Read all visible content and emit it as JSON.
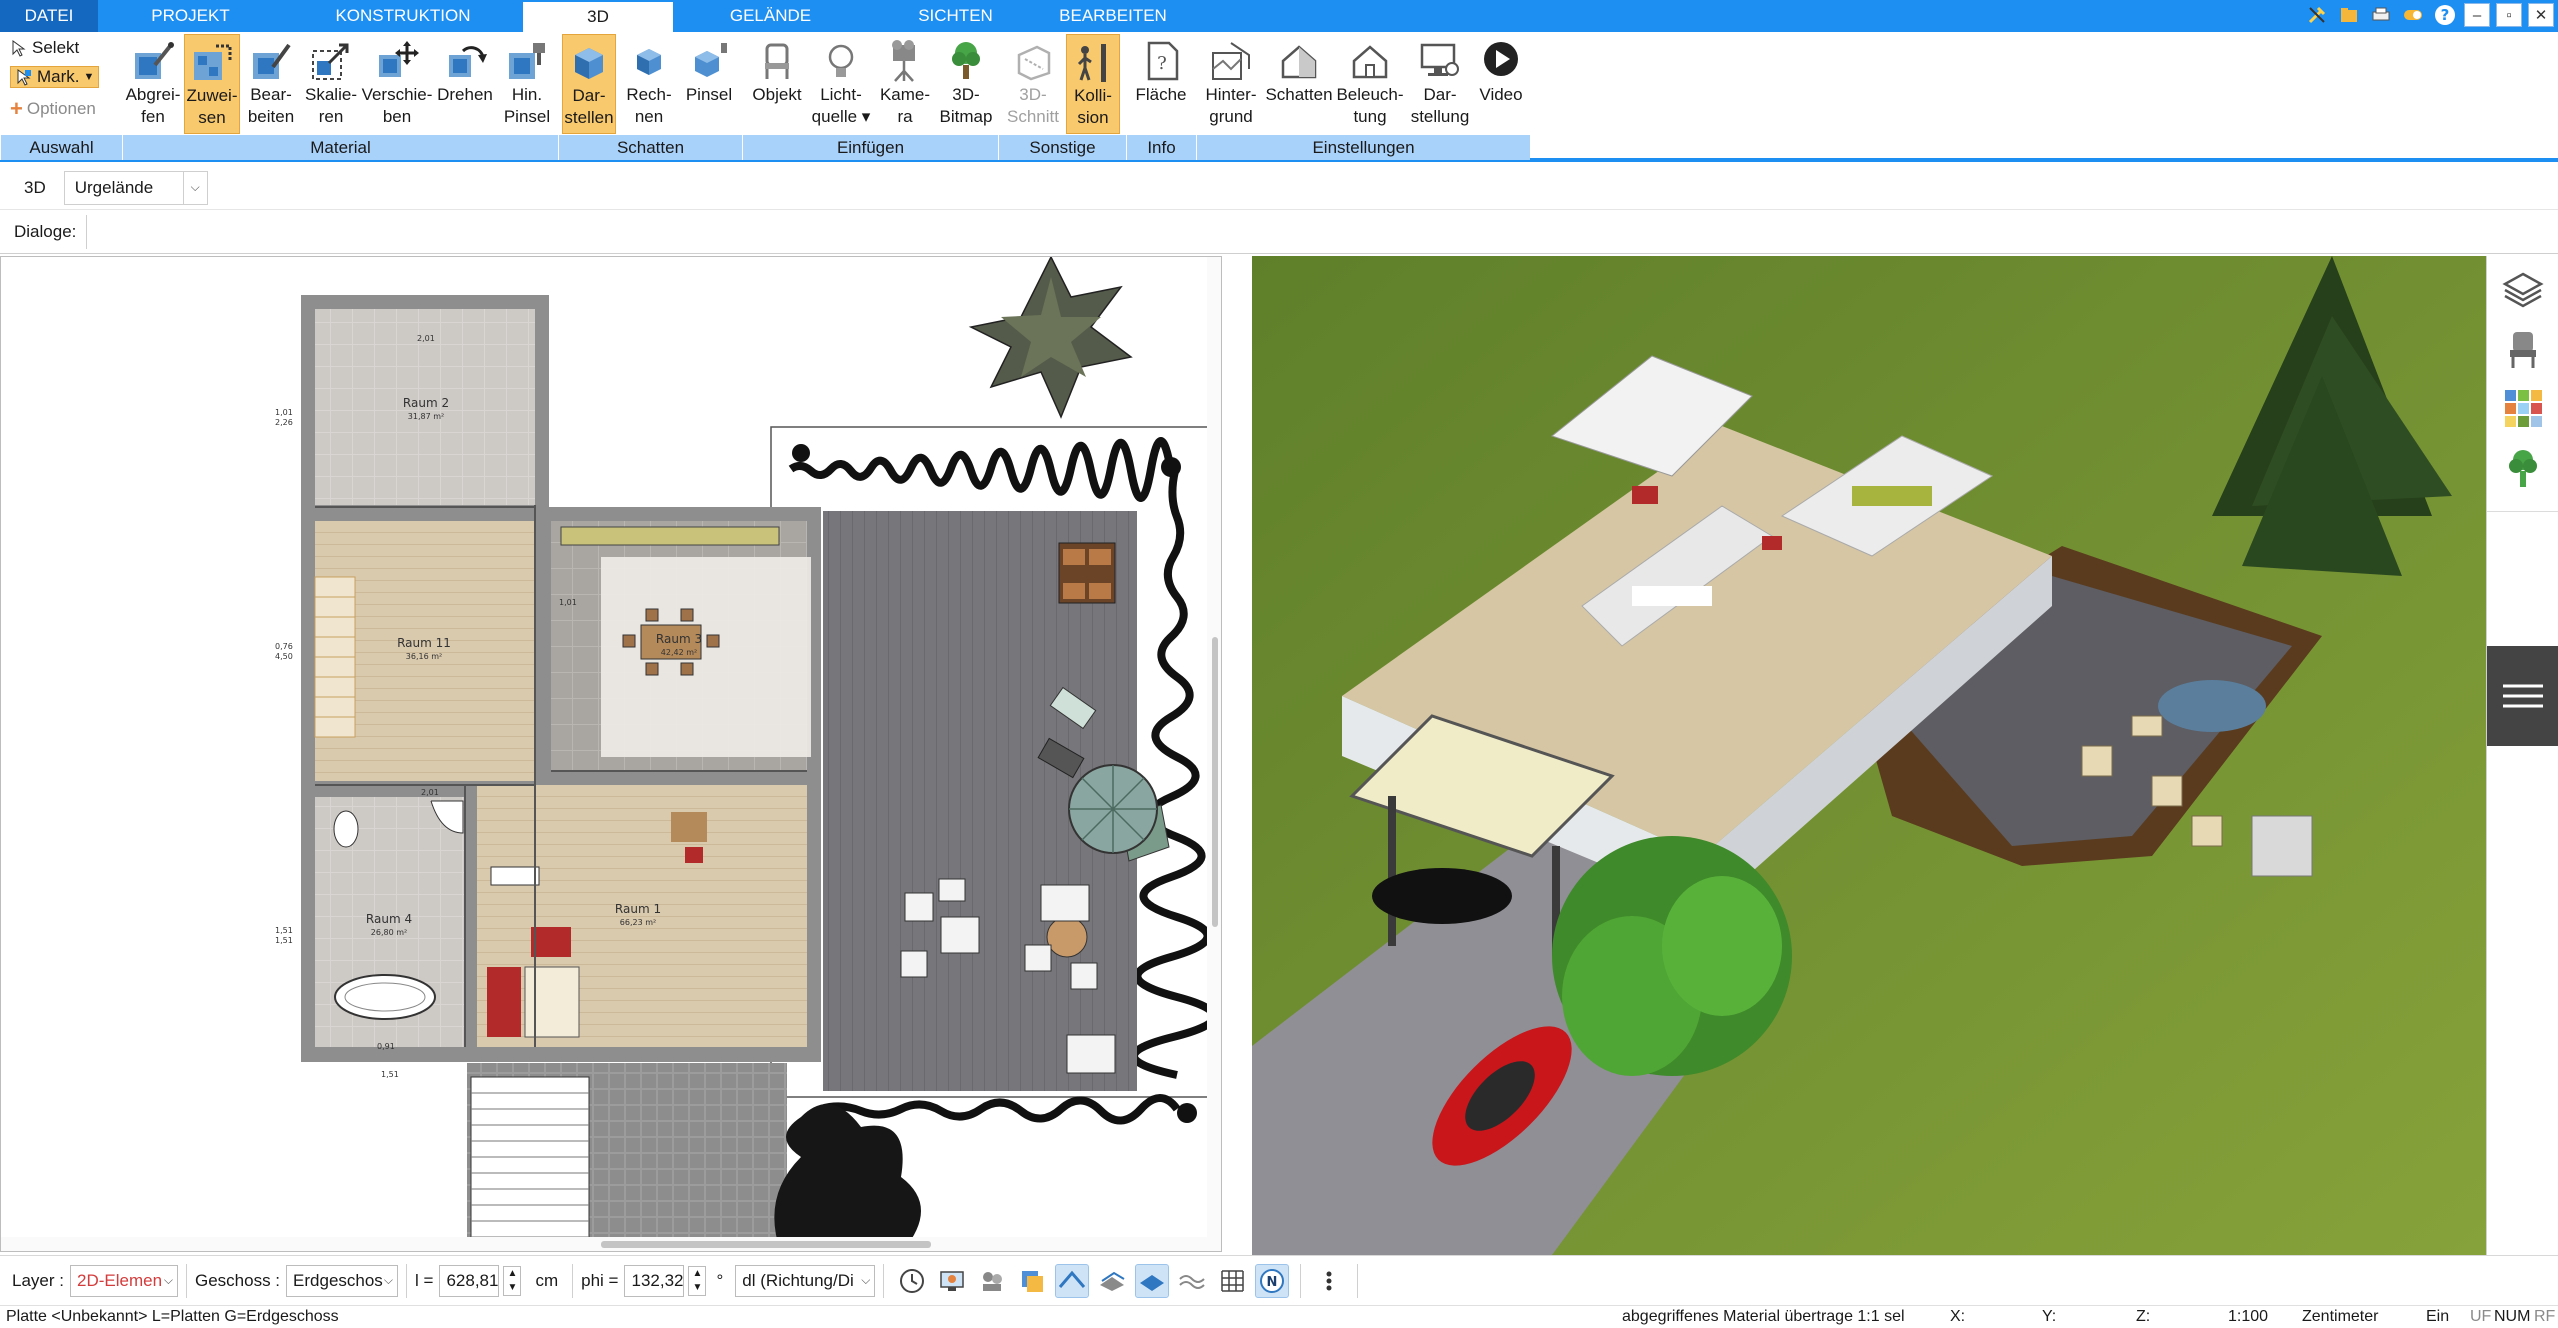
{
  "tabs": [
    {
      "label": "DATEI",
      "active": false
    },
    {
      "label": "PROJEKT",
      "active": false
    },
    {
      "label": "KONSTRUKTION",
      "active": false
    },
    {
      "label": "3D",
      "active": true
    },
    {
      "label": "GELÄNDE",
      "active": false
    },
    {
      "label": "SICHTEN",
      "active": false
    },
    {
      "label": "BEARBEITEN",
      "active": false
    }
  ],
  "window_controls": [
    "tools-icon",
    "folder-icon",
    "print-icon",
    "toggle-icon",
    "help-icon",
    "minimize-icon",
    "restore-icon",
    "close-icon"
  ],
  "ribbon": {
    "auswahl": {
      "label": "Auswahl",
      "selekt": "Selekt",
      "mark": "Mark.",
      "optionen": "Optionen"
    },
    "material": {
      "label": "Material",
      "buttons": [
        {
          "line1": "Abgrei-",
          "line2": "fen",
          "icon": "eyedropper-icon",
          "active": false
        },
        {
          "line1": "Zuwei-",
          "line2": "sen",
          "icon": "assign-material-icon",
          "active": true
        },
        {
          "line1": "Bear-",
          "line2": "beiten",
          "icon": "edit-material-icon",
          "active": false
        },
        {
          "line1": "Skalie-",
          "line2": "ren",
          "icon": "scale-icon",
          "active": false
        },
        {
          "line1": "Verschie-",
          "line2": "ben",
          "icon": "move-icon",
          "active": false
        },
        {
          "line1": "Drehen",
          "line2": "",
          "icon": "rotate-icon",
          "active": false
        },
        {
          "line1": "Hin.",
          "line2": "Pinsel",
          "icon": "brush-icon",
          "active": false
        }
      ]
    },
    "schatten": {
      "label": "Schatten",
      "buttons": [
        {
          "line1": "Dar-",
          "line2": "stellen",
          "icon": "shadow-display-icon",
          "active": true
        },
        {
          "line1": "Rech-",
          "line2": "nen",
          "icon": "shadow-calc-icon",
          "active": false
        },
        {
          "line1": "Pinsel",
          "line2": "",
          "icon": "shadow-brush-icon",
          "active": false
        }
      ]
    },
    "einfuegen": {
      "label": "Einfügen",
      "buttons": [
        {
          "line1": "Objekt",
          "line2": "",
          "icon": "chair-icon",
          "active": false
        },
        {
          "line1": "Licht-",
          "line2": "quelle ▾",
          "icon": "bulb-icon",
          "active": false
        },
        {
          "line1": "Kame-",
          "line2": "ra",
          "icon": "camera-icon",
          "active": false
        },
        {
          "line1": "3D-",
          "line2": "Bitmap",
          "icon": "tree-icon",
          "active": false
        }
      ]
    },
    "sonstige": {
      "label": "Sonstige",
      "buttons": [
        {
          "line1": "3D-",
          "line2": "Schnitt",
          "icon": "section-icon",
          "active": false,
          "disabled": true
        },
        {
          "line1": "Kolli-",
          "line2": "sion",
          "icon": "collision-icon",
          "active": true
        }
      ]
    },
    "info": {
      "label": "Info",
      "buttons": [
        {
          "line1": "Fläche",
          "line2": "",
          "icon": "area-icon",
          "active": false
        }
      ]
    },
    "einstellungen": {
      "label": "Einstellungen",
      "buttons": [
        {
          "line1": "Hinter-",
          "line2": "grund",
          "icon": "background-icon",
          "active": false
        },
        {
          "line1": "Schatten",
          "line2": "",
          "icon": "house-shadow-icon",
          "active": false
        },
        {
          "line1": "Beleuch-",
          "line2": "tung",
          "icon": "house-light-icon",
          "active": false
        },
        {
          "line1": "Dar-",
          "line2": "stellung",
          "icon": "display-settings-icon",
          "active": false
        },
        {
          "line1": "Video",
          "line2": "",
          "icon": "play-icon",
          "active": false
        }
      ]
    }
  },
  "row3d": {
    "label": "3D",
    "combo_value": "Urgelände"
  },
  "dialoge": {
    "label": "Dialoge:"
  },
  "plan": {
    "rooms": [
      {
        "name": "Raum 2",
        "area": "31,87 m²"
      },
      {
        "name": "Raum 11",
        "area": "36,16 m²"
      },
      {
        "name": "Raum 3",
        "area": "42,42 m²"
      },
      {
        "name": "Raum 4",
        "area": "26,80 m²"
      },
      {
        "name": "Raum 1",
        "area": "66,23 m²"
      }
    ],
    "dims": [
      "1,01",
      "2,26",
      "0,76",
      "4,50",
      "1,51",
      "1,51",
      "0,91",
      "2,01",
      "2,01",
      "1,01",
      "1,51"
    ]
  },
  "sidebar_icons": [
    "layers-icon",
    "chair-catalog-icon",
    "material-palette-icon",
    "plant-icon"
  ],
  "bottombar": {
    "layer_label": "Layer :",
    "layer_value": "2D-Elemen",
    "geschoss_label": "Geschoss :",
    "geschoss_value": "Erdgeschos",
    "l_label": "l  =",
    "l_value": "628,81",
    "l_unit": "cm",
    "phi_label": "phi  =",
    "phi_value": "132,32",
    "phi_unit": "°",
    "dl_value": "dl (Richtung/Di",
    "tool_icons": [
      "clock-icon",
      "monitor-icon",
      "group-icon",
      "layer-stack-icon",
      "roof-icon",
      "hatch-icon",
      "plane-icon",
      "terrain-icon",
      "grid-icon",
      "north-icon",
      "more-icon"
    ]
  },
  "status": {
    "left": "Platte <Unbekannt> L=Platten G=Erdgeschoss",
    "message": "abgegriffenes Material übertrage 1:1 sel",
    "x": "X:",
    "y": "Y:",
    "z": "Z:",
    "scale": "1:100",
    "unit": "Zentimeter",
    "mode": "Ein",
    "uf": "UF",
    "num": "NUM",
    "rf": "RF"
  },
  "colors": {
    "accent": "#1e8ff2",
    "group_label": "#a9d2fb",
    "active_button": "#f9c96d",
    "grass": "#7a9a34",
    "deck": "#6e6e72",
    "wall": "#e9ecef",
    "floor_wood": "#d6c3a2",
    "car_red": "#c8161b"
  }
}
